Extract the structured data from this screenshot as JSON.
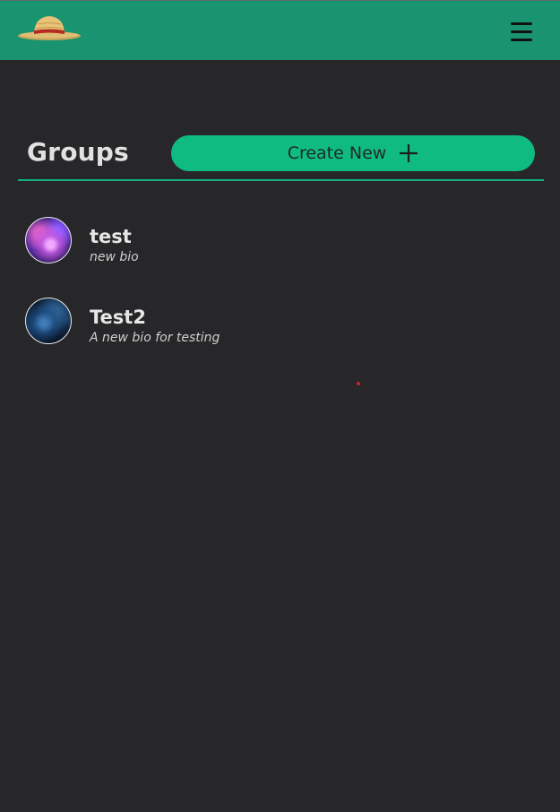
{
  "header": {
    "logo_icon": "straw-hat-icon",
    "menu_icon": "hamburger-menu-icon",
    "accent_color": "#1a9370"
  },
  "main": {
    "title": "Groups",
    "create_button_label": "Create New",
    "create_button_icon": "plus-icon",
    "button_color": "#10bb82"
  },
  "groups": [
    {
      "name": "test",
      "bio": "new bio"
    },
    {
      "name": "Test2",
      "bio": "A new bio for testing"
    }
  ]
}
